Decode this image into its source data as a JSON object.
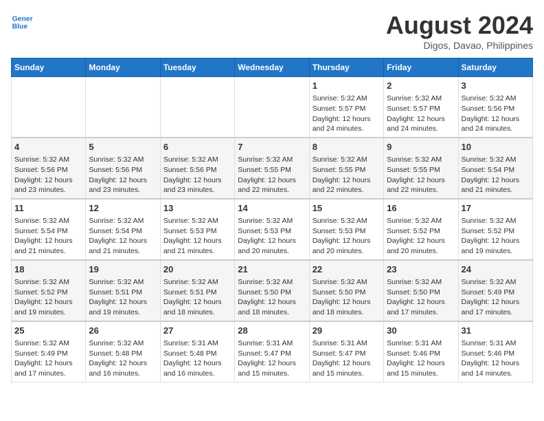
{
  "header": {
    "logo_line1": "General",
    "logo_line2": "Blue",
    "title": "August 2024",
    "subtitle": "Digos, Davao, Philippines"
  },
  "days_of_week": [
    "Sunday",
    "Monday",
    "Tuesday",
    "Wednesday",
    "Thursday",
    "Friday",
    "Saturday"
  ],
  "weeks": [
    [
      {
        "day": "",
        "content": ""
      },
      {
        "day": "",
        "content": ""
      },
      {
        "day": "",
        "content": ""
      },
      {
        "day": "",
        "content": ""
      },
      {
        "day": "1",
        "content": "Sunrise: 5:32 AM\nSunset: 5:57 PM\nDaylight: 12 hours\nand 24 minutes."
      },
      {
        "day": "2",
        "content": "Sunrise: 5:32 AM\nSunset: 5:57 PM\nDaylight: 12 hours\nand 24 minutes."
      },
      {
        "day": "3",
        "content": "Sunrise: 5:32 AM\nSunset: 5:56 PM\nDaylight: 12 hours\nand 24 minutes."
      }
    ],
    [
      {
        "day": "4",
        "content": "Sunrise: 5:32 AM\nSunset: 5:56 PM\nDaylight: 12 hours\nand 23 minutes."
      },
      {
        "day": "5",
        "content": "Sunrise: 5:32 AM\nSunset: 5:56 PM\nDaylight: 12 hours\nand 23 minutes."
      },
      {
        "day": "6",
        "content": "Sunrise: 5:32 AM\nSunset: 5:56 PM\nDaylight: 12 hours\nand 23 minutes."
      },
      {
        "day": "7",
        "content": "Sunrise: 5:32 AM\nSunset: 5:55 PM\nDaylight: 12 hours\nand 22 minutes."
      },
      {
        "day": "8",
        "content": "Sunrise: 5:32 AM\nSunset: 5:55 PM\nDaylight: 12 hours\nand 22 minutes."
      },
      {
        "day": "9",
        "content": "Sunrise: 5:32 AM\nSunset: 5:55 PM\nDaylight: 12 hours\nand 22 minutes."
      },
      {
        "day": "10",
        "content": "Sunrise: 5:32 AM\nSunset: 5:54 PM\nDaylight: 12 hours\nand 21 minutes."
      }
    ],
    [
      {
        "day": "11",
        "content": "Sunrise: 5:32 AM\nSunset: 5:54 PM\nDaylight: 12 hours\nand 21 minutes."
      },
      {
        "day": "12",
        "content": "Sunrise: 5:32 AM\nSunset: 5:54 PM\nDaylight: 12 hours\nand 21 minutes."
      },
      {
        "day": "13",
        "content": "Sunrise: 5:32 AM\nSunset: 5:53 PM\nDaylight: 12 hours\nand 21 minutes."
      },
      {
        "day": "14",
        "content": "Sunrise: 5:32 AM\nSunset: 5:53 PM\nDaylight: 12 hours\nand 20 minutes."
      },
      {
        "day": "15",
        "content": "Sunrise: 5:32 AM\nSunset: 5:53 PM\nDaylight: 12 hours\nand 20 minutes."
      },
      {
        "day": "16",
        "content": "Sunrise: 5:32 AM\nSunset: 5:52 PM\nDaylight: 12 hours\nand 20 minutes."
      },
      {
        "day": "17",
        "content": "Sunrise: 5:32 AM\nSunset: 5:52 PM\nDaylight: 12 hours\nand 19 minutes."
      }
    ],
    [
      {
        "day": "18",
        "content": "Sunrise: 5:32 AM\nSunset: 5:52 PM\nDaylight: 12 hours\nand 19 minutes."
      },
      {
        "day": "19",
        "content": "Sunrise: 5:32 AM\nSunset: 5:51 PM\nDaylight: 12 hours\nand 19 minutes."
      },
      {
        "day": "20",
        "content": "Sunrise: 5:32 AM\nSunset: 5:51 PM\nDaylight: 12 hours\nand 18 minutes."
      },
      {
        "day": "21",
        "content": "Sunrise: 5:32 AM\nSunset: 5:50 PM\nDaylight: 12 hours\nand 18 minutes."
      },
      {
        "day": "22",
        "content": "Sunrise: 5:32 AM\nSunset: 5:50 PM\nDaylight: 12 hours\nand 18 minutes."
      },
      {
        "day": "23",
        "content": "Sunrise: 5:32 AM\nSunset: 5:50 PM\nDaylight: 12 hours\nand 17 minutes."
      },
      {
        "day": "24",
        "content": "Sunrise: 5:32 AM\nSunset: 5:49 PM\nDaylight: 12 hours\nand 17 minutes."
      }
    ],
    [
      {
        "day": "25",
        "content": "Sunrise: 5:32 AM\nSunset: 5:49 PM\nDaylight: 12 hours\nand 17 minutes."
      },
      {
        "day": "26",
        "content": "Sunrise: 5:32 AM\nSunset: 5:48 PM\nDaylight: 12 hours\nand 16 minutes."
      },
      {
        "day": "27",
        "content": "Sunrise: 5:31 AM\nSunset: 5:48 PM\nDaylight: 12 hours\nand 16 minutes."
      },
      {
        "day": "28",
        "content": "Sunrise: 5:31 AM\nSunset: 5:47 PM\nDaylight: 12 hours\nand 15 minutes."
      },
      {
        "day": "29",
        "content": "Sunrise: 5:31 AM\nSunset: 5:47 PM\nDaylight: 12 hours\nand 15 minutes."
      },
      {
        "day": "30",
        "content": "Sunrise: 5:31 AM\nSunset: 5:46 PM\nDaylight: 12 hours\nand 15 minutes."
      },
      {
        "day": "31",
        "content": "Sunrise: 5:31 AM\nSunset: 5:46 PM\nDaylight: 12 hours\nand 14 minutes."
      }
    ]
  ]
}
